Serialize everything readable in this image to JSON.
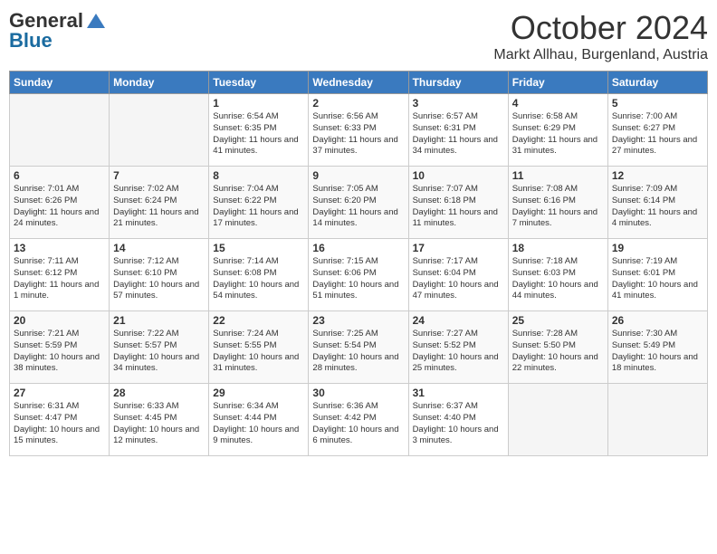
{
  "logo": {
    "general": "General",
    "blue": "Blue"
  },
  "header": {
    "month": "October 2024",
    "location": "Markt Allhau, Burgenland, Austria"
  },
  "weekdays": [
    "Sunday",
    "Monday",
    "Tuesday",
    "Wednesday",
    "Thursday",
    "Friday",
    "Saturday"
  ],
  "weeks": [
    [
      {
        "day": "",
        "empty": true
      },
      {
        "day": "",
        "empty": true
      },
      {
        "day": "1",
        "sunrise": "Sunrise: 6:54 AM",
        "sunset": "Sunset: 6:35 PM",
        "daylight": "Daylight: 11 hours and 41 minutes."
      },
      {
        "day": "2",
        "sunrise": "Sunrise: 6:56 AM",
        "sunset": "Sunset: 6:33 PM",
        "daylight": "Daylight: 11 hours and 37 minutes."
      },
      {
        "day": "3",
        "sunrise": "Sunrise: 6:57 AM",
        "sunset": "Sunset: 6:31 PM",
        "daylight": "Daylight: 11 hours and 34 minutes."
      },
      {
        "day": "4",
        "sunrise": "Sunrise: 6:58 AM",
        "sunset": "Sunset: 6:29 PM",
        "daylight": "Daylight: 11 hours and 31 minutes."
      },
      {
        "day": "5",
        "sunrise": "Sunrise: 7:00 AM",
        "sunset": "Sunset: 6:27 PM",
        "daylight": "Daylight: 11 hours and 27 minutes."
      }
    ],
    [
      {
        "day": "6",
        "sunrise": "Sunrise: 7:01 AM",
        "sunset": "Sunset: 6:26 PM",
        "daylight": "Daylight: 11 hours and 24 minutes."
      },
      {
        "day": "7",
        "sunrise": "Sunrise: 7:02 AM",
        "sunset": "Sunset: 6:24 PM",
        "daylight": "Daylight: 11 hours and 21 minutes."
      },
      {
        "day": "8",
        "sunrise": "Sunrise: 7:04 AM",
        "sunset": "Sunset: 6:22 PM",
        "daylight": "Daylight: 11 hours and 17 minutes."
      },
      {
        "day": "9",
        "sunrise": "Sunrise: 7:05 AM",
        "sunset": "Sunset: 6:20 PM",
        "daylight": "Daylight: 11 hours and 14 minutes."
      },
      {
        "day": "10",
        "sunrise": "Sunrise: 7:07 AM",
        "sunset": "Sunset: 6:18 PM",
        "daylight": "Daylight: 11 hours and 11 minutes."
      },
      {
        "day": "11",
        "sunrise": "Sunrise: 7:08 AM",
        "sunset": "Sunset: 6:16 PM",
        "daylight": "Daylight: 11 hours and 7 minutes."
      },
      {
        "day": "12",
        "sunrise": "Sunrise: 7:09 AM",
        "sunset": "Sunset: 6:14 PM",
        "daylight": "Daylight: 11 hours and 4 minutes."
      }
    ],
    [
      {
        "day": "13",
        "sunrise": "Sunrise: 7:11 AM",
        "sunset": "Sunset: 6:12 PM",
        "daylight": "Daylight: 11 hours and 1 minute."
      },
      {
        "day": "14",
        "sunrise": "Sunrise: 7:12 AM",
        "sunset": "Sunset: 6:10 PM",
        "daylight": "Daylight: 10 hours and 57 minutes."
      },
      {
        "day": "15",
        "sunrise": "Sunrise: 7:14 AM",
        "sunset": "Sunset: 6:08 PM",
        "daylight": "Daylight: 10 hours and 54 minutes."
      },
      {
        "day": "16",
        "sunrise": "Sunrise: 7:15 AM",
        "sunset": "Sunset: 6:06 PM",
        "daylight": "Daylight: 10 hours and 51 minutes."
      },
      {
        "day": "17",
        "sunrise": "Sunrise: 7:17 AM",
        "sunset": "Sunset: 6:04 PM",
        "daylight": "Daylight: 10 hours and 47 minutes."
      },
      {
        "day": "18",
        "sunrise": "Sunrise: 7:18 AM",
        "sunset": "Sunset: 6:03 PM",
        "daylight": "Daylight: 10 hours and 44 minutes."
      },
      {
        "day": "19",
        "sunrise": "Sunrise: 7:19 AM",
        "sunset": "Sunset: 6:01 PM",
        "daylight": "Daylight: 10 hours and 41 minutes."
      }
    ],
    [
      {
        "day": "20",
        "sunrise": "Sunrise: 7:21 AM",
        "sunset": "Sunset: 5:59 PM",
        "daylight": "Daylight: 10 hours and 38 minutes."
      },
      {
        "day": "21",
        "sunrise": "Sunrise: 7:22 AM",
        "sunset": "Sunset: 5:57 PM",
        "daylight": "Daylight: 10 hours and 34 minutes."
      },
      {
        "day": "22",
        "sunrise": "Sunrise: 7:24 AM",
        "sunset": "Sunset: 5:55 PM",
        "daylight": "Daylight: 10 hours and 31 minutes."
      },
      {
        "day": "23",
        "sunrise": "Sunrise: 7:25 AM",
        "sunset": "Sunset: 5:54 PM",
        "daylight": "Daylight: 10 hours and 28 minutes."
      },
      {
        "day": "24",
        "sunrise": "Sunrise: 7:27 AM",
        "sunset": "Sunset: 5:52 PM",
        "daylight": "Daylight: 10 hours and 25 minutes."
      },
      {
        "day": "25",
        "sunrise": "Sunrise: 7:28 AM",
        "sunset": "Sunset: 5:50 PM",
        "daylight": "Daylight: 10 hours and 22 minutes."
      },
      {
        "day": "26",
        "sunrise": "Sunrise: 7:30 AM",
        "sunset": "Sunset: 5:49 PM",
        "daylight": "Daylight: 10 hours and 18 minutes."
      }
    ],
    [
      {
        "day": "27",
        "sunrise": "Sunrise: 6:31 AM",
        "sunset": "Sunset: 4:47 PM",
        "daylight": "Daylight: 10 hours and 15 minutes."
      },
      {
        "day": "28",
        "sunrise": "Sunrise: 6:33 AM",
        "sunset": "Sunset: 4:45 PM",
        "daylight": "Daylight: 10 hours and 12 minutes."
      },
      {
        "day": "29",
        "sunrise": "Sunrise: 6:34 AM",
        "sunset": "Sunset: 4:44 PM",
        "daylight": "Daylight: 10 hours and 9 minutes."
      },
      {
        "day": "30",
        "sunrise": "Sunrise: 6:36 AM",
        "sunset": "Sunset: 4:42 PM",
        "daylight": "Daylight: 10 hours and 6 minutes."
      },
      {
        "day": "31",
        "sunrise": "Sunrise: 6:37 AM",
        "sunset": "Sunset: 4:40 PM",
        "daylight": "Daylight: 10 hours and 3 minutes."
      },
      {
        "day": "",
        "empty": true
      },
      {
        "day": "",
        "empty": true
      }
    ]
  ]
}
